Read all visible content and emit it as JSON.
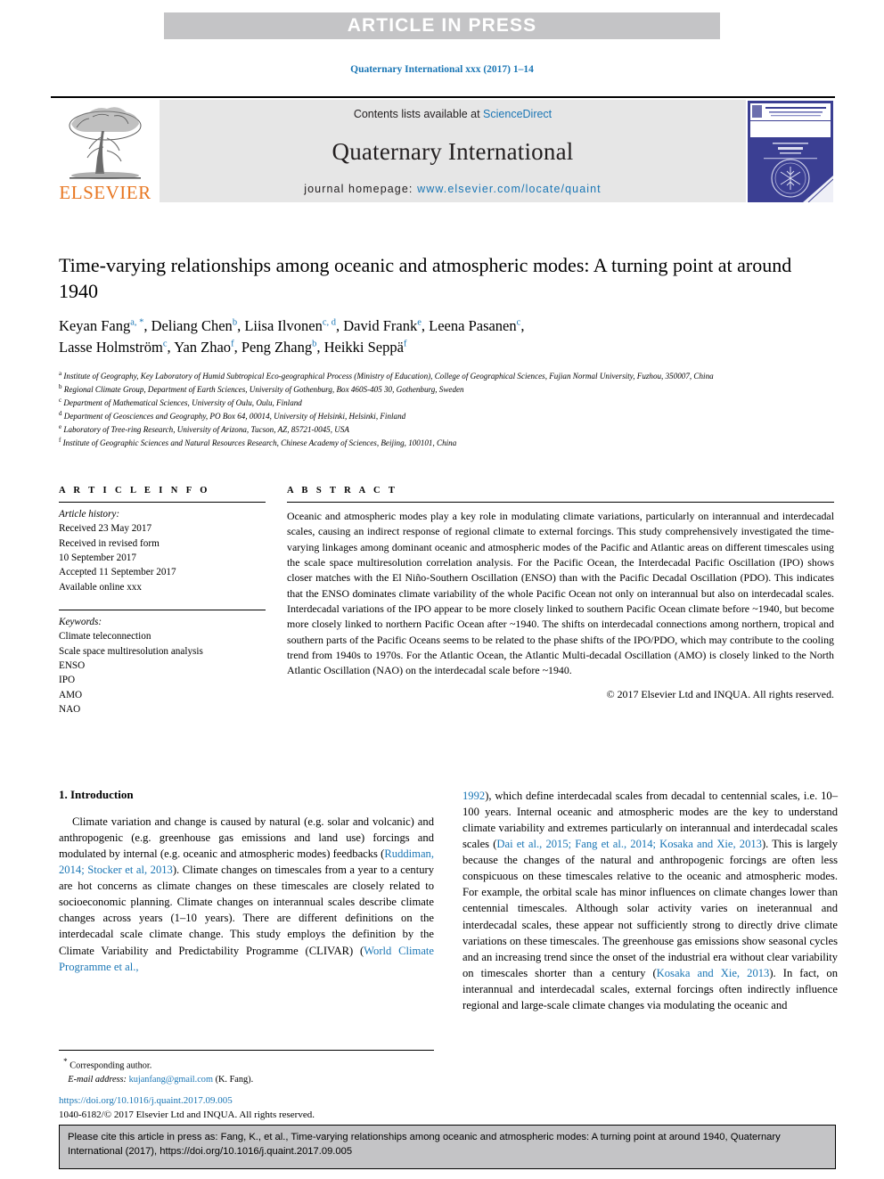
{
  "banner": {
    "label": "ARTICLE IN PRESS"
  },
  "running_head": "Quaternary International xxx (2017) 1–14",
  "masthead": {
    "publisher_logo_text": "ELSEVIER",
    "contents_prefix": "Contents lists available at ",
    "contents_link": "ScienceDirect",
    "journal_name": "Quaternary International",
    "homepage_prefix": "journal homepage: ",
    "homepage_url": "www.elsevier.com/locate/quaint",
    "cover_alt": "journal-cover-thumbnail"
  },
  "article": {
    "title": "Time-varying relationships among oceanic and atmospheric modes: A turning point at around 1940",
    "authors_line1": "Keyan Fang <a,*>, Deliang Chen <b>, Liisa Ilvonen <c,d>, David Frank <e>, Leena Pasanen <c>,",
    "authors_line2": "Lasse Holmström <c>, Yan Zhao <f>, Peng Zhang <b>, Heikki Seppä <f>",
    "authors": [
      {
        "name": "Keyan Fang",
        "marks": "a, *",
        "sep": ", "
      },
      {
        "name": "Deliang Chen",
        "marks": "b",
        "sep": ", "
      },
      {
        "name": "Liisa Ilvonen",
        "marks": "c, d",
        "sep": ", "
      },
      {
        "name": "David Frank",
        "marks": "e",
        "sep": ", "
      },
      {
        "name": "Leena Pasanen",
        "marks": "c",
        "sep": ","
      },
      {
        "name": "Lasse Holmström",
        "marks": "c",
        "sep": ", "
      },
      {
        "name": "Yan Zhao",
        "marks": "f",
        "sep": ", "
      },
      {
        "name": "Peng Zhang",
        "marks": "b",
        "sep": ", "
      },
      {
        "name": "Heikki Seppä",
        "marks": "f",
        "sep": ""
      }
    ],
    "affiliations": [
      {
        "label": "a",
        "text": "Institute of Geography, Key Laboratory of Humid Subtropical Eco-geographical Process (Ministry of Education), College of Geographical Sciences, Fujian Normal University, Fuzhou, 350007, China"
      },
      {
        "label": "b",
        "text": "Regional Climate Group, Department of Earth Sciences, University of Gothenburg, Box 460S-405 30, Gothenburg, Sweden"
      },
      {
        "label": "c",
        "text": "Department of Mathematical Sciences, University of Oulu, Oulu, Finland"
      },
      {
        "label": "d",
        "text": "Department of Geosciences and Geography, PO Box 64, 00014, University of Helsinki, Helsinki, Finland"
      },
      {
        "label": "e",
        "text": "Laboratory of Tree-ring Research, University of Arizona, Tucson, AZ, 85721-0045, USA"
      },
      {
        "label": "f",
        "text": "Institute of Geographic Sciences and Natural Resources Research, Chinese Academy of Sciences, Beijing, 100101, China"
      }
    ]
  },
  "article_info": {
    "heading": "A R T I C L E   I N F O",
    "history_label": "Article history:",
    "history": [
      "Received 23 May 2017",
      "Received in revised form",
      "10 September 2017",
      "Accepted 11 September 2017",
      "Available online xxx"
    ],
    "keywords_label": "Keywords:",
    "keywords": [
      "Climate teleconnection",
      "Scale space multiresolution analysis",
      "ENSO",
      "IPO",
      "AMO",
      "NAO"
    ]
  },
  "abstract": {
    "heading": "A B S T R A C T",
    "text": "Oceanic and atmospheric modes play a key role in modulating climate variations, particularly on interannual and interdecadal scales, causing an indirect response of regional climate to external forcings. This study comprehensively investigated the time-varying linkages among dominant oceanic and atmospheric modes of the Pacific and Atlantic areas on different timescales using the scale space multiresolution correlation analysis. For the Pacific Ocean, the Interdecadal Pacific Oscillation (IPO) shows closer matches with the El Niño-Southern Oscillation (ENSO) than with the Pacific Decadal Oscillation (PDO). This indicates that the ENSO dominates climate variability of the whole Pacific Ocean not only on interannual but also on interdecadal scales. Interdecadal variations of the IPO appear to be more closely linked to southern Pacific Ocean climate before ~1940, but become more closely linked to northern Pacific Ocean after ~1940. The shifts on interdecadal connections among northern, tropical and southern parts of the Pacific Oceans seems to be related to the phase shifts of the IPO/PDO, which may contribute to the cooling trend from 1940s to 1970s. For the Atlantic Ocean, the Atlantic Multi-decadal Oscillation (AMO) is closely linked to the North Atlantic Oscillation (NAO) on the interdecadal scale before ~1940.",
    "copyright": "© 2017 Elsevier Ltd and INQUA. All rights reserved."
  },
  "introduction": {
    "heading": "1.  Introduction",
    "left_paragraph_part1": "Climate variation and change is caused by natural (e.g. solar and volcanic) and anthropogenic (e.g. greenhouse gas emissions and land use) forcings and modulated by internal (e.g. oceanic and atmospheric modes) feedbacks (",
    "cite1": "Ruddiman, 2014; Stocker et al, 2013",
    "left_paragraph_part2": "). Climate changes on timescales from a year to a century are hot concerns as climate changes on these timescales are closely related to socioeconomic planning. Climate changes on interannual scales describe climate changes across years (1–10 years). There are different definitions on the interdecadal scale climate change. This study employs the definition by the Climate Variability and Predictability Programme (CLIVAR) (",
    "cite2": "World Climate Programme et al.,",
    "right_cite2_cont": "1992",
    "right_paragraph_part1": "), which define interdecadal scales from decadal to centennial scales, i.e. 10–100 years. Internal oceanic and atmospheric modes are the key to understand climate variability and extremes particularly on interannual and interdecadal scales scales (",
    "cite3": "Dai et al., 2015; Fang et al., 2014; Kosaka and Xie, 2013",
    "right_paragraph_part2": "). This is largely because the changes of the natural and anthropogenic forcings are often less conspicuous on these timescales relative to the oceanic and atmospheric modes. For example, the orbital scale has minor influences on climate changes lower than centennial timescales. Although solar activity varies on ineterannual and interdecadal scales, these appear not sufficiently strong to directly drive climate variations on these timescales. The greenhouse gas emissions show seasonal cycles and an increasing trend since the onset of the industrial era without clear variability on timescales shorter than a century (",
    "cite4": "Kosaka and Xie, 2013",
    "right_paragraph_part3": "). In fact, on interannual and interdecadal scales, external forcings often indirectly influence regional and large-scale climate changes via modulating the oceanic and"
  },
  "footnote": {
    "corresponding_star": "*",
    "corresponding_label": "Corresponding author.",
    "email_label": "E-mail address:",
    "email": "kujanfang@gmail.com",
    "email_suffix": "(K. Fang)."
  },
  "doi_block": {
    "doi_url": "https://doi.org/10.1016/j.quaint.2017.09.005",
    "issn_line": "1040-6182/© 2017 Elsevier Ltd and INQUA. All rights reserved."
  },
  "cite_box": {
    "text": "Please cite this article in press as: Fang, K., et al., Time-varying relationships among oceanic and atmospheric modes: A turning point at around 1940, Quaternary International (2017), https://doi.org/10.1016/j.quaint.2017.09.005"
  },
  "colors": {
    "link": "#1a76b5",
    "banner_bg": "#c4c4c6",
    "masthead_bg": "#e6e6e6",
    "elsevier_orange": "#e87722",
    "cover_blue": "#3b3f93"
  }
}
